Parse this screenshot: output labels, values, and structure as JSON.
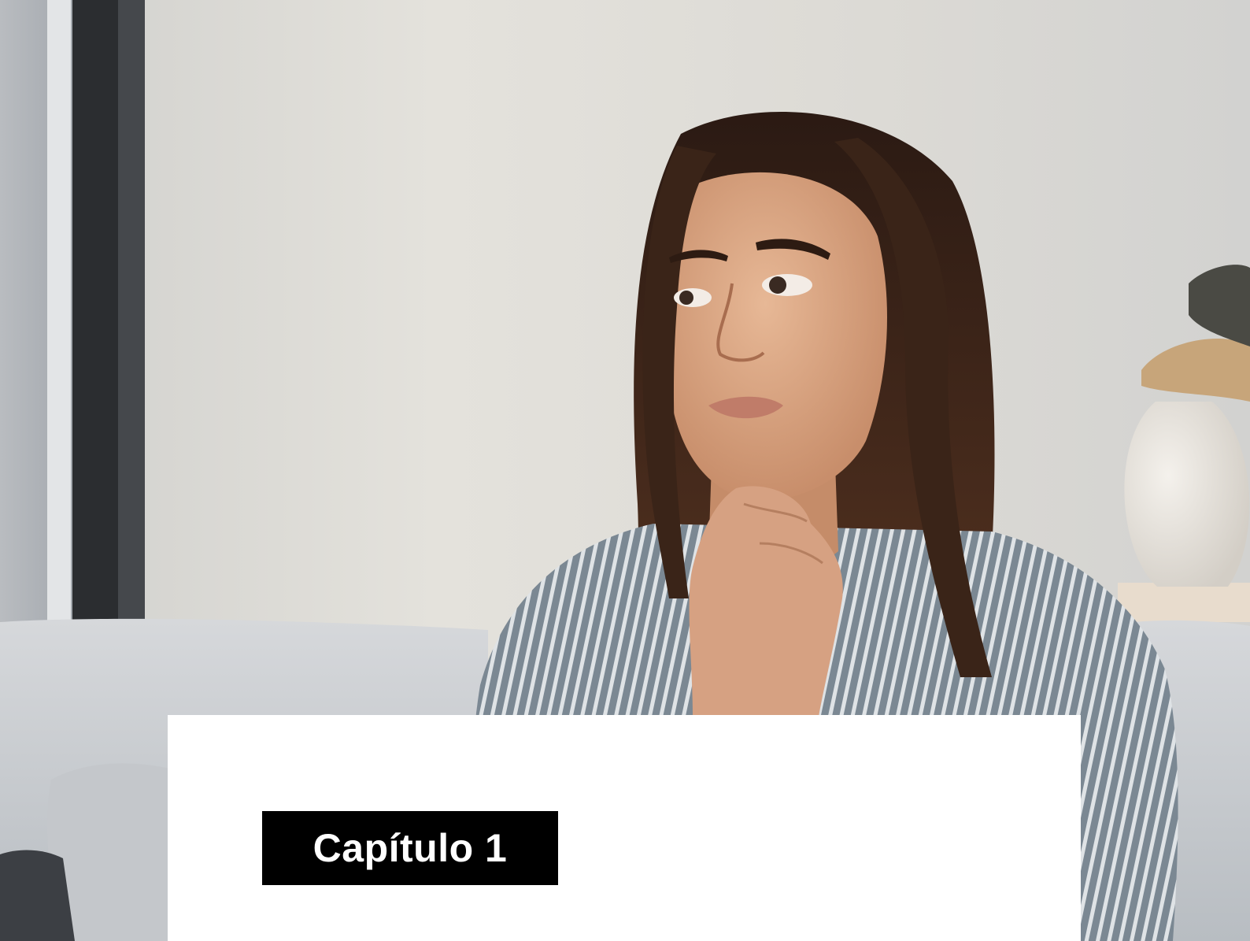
{
  "colors": {
    "wall": "#dcdad4",
    "panel": "#ffffff",
    "badge_background": "#000000",
    "badge_text": "#ffffff",
    "hair": "#3a2519",
    "shirt": "#6f7c87",
    "sofa": "#c9cdd1"
  },
  "chapter": {
    "label": "Capítulo 1"
  }
}
